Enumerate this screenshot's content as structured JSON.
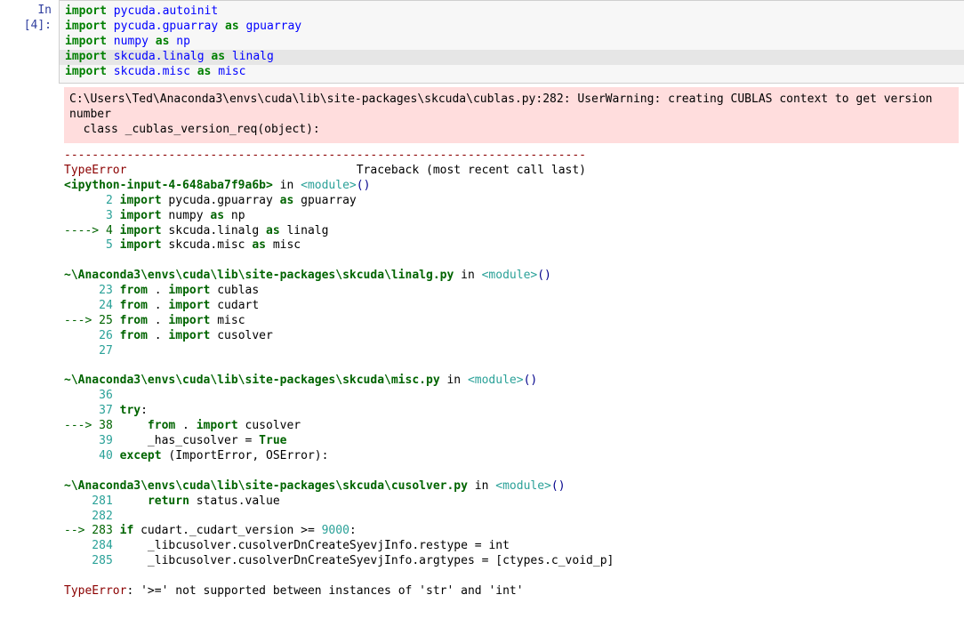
{
  "cell": {
    "prompt": "In [4]:",
    "input": {
      "l1": {
        "kw": "import",
        "mod": "pycuda.autoinit"
      },
      "l2": {
        "kw": "import",
        "mod": "pycuda.gpuarray",
        "as": "as",
        "alias": "gpuarray"
      },
      "l3": {
        "kw": "import",
        "mod": "numpy",
        "as": "as",
        "alias": "np"
      },
      "l4": {
        "kw": "import",
        "mod": "skcuda.linalg",
        "as": "as",
        "alias": "linalg"
      },
      "l5": {
        "kw": "import",
        "mod": "skcuda.misc",
        "as": "as",
        "alias": "misc"
      }
    }
  },
  "output": {
    "warning": {
      "line1": "C:\\Users\\Ted\\Anaconda3\\envs\\cuda\\lib\\site-packages\\skcuda\\cublas.py:282: UserWarning: creating CUBLAS context to get version number",
      "line2": "  class _cublas_version_req(object):"
    },
    "sep": "---------------------------------------------------------------------------",
    "errname": "TypeError",
    "tb_label": "                                 Traceback (most recent call last)",
    "f1": {
      "file": "<ipython-input-4-648aba7f9a6b>",
      "in": " in ",
      "mod": "<module>",
      "paren": "()",
      "l2": {
        "num": "      2 ",
        "kw": "import",
        "txt": " pycuda.gpuarray ",
        "as": "as",
        "txt2": " gpuarray"
      },
      "l3": {
        "num": "      3 ",
        "kw": "import",
        "txt": " numpy ",
        "as": "as",
        "txt2": " np"
      },
      "l4": {
        "arr": "----> 4 ",
        "kw": "import",
        "txt": " skcuda.linalg ",
        "as": "as",
        "txt2": " linalg"
      },
      "l5": {
        "num": "      5 ",
        "kw": "import",
        "txt": " skcuda.misc ",
        "as": "as",
        "txt2": " misc"
      }
    },
    "f2": {
      "file": "~\\Anaconda3\\envs\\cuda\\lib\\site-packages\\skcuda\\linalg.py",
      "in": " in ",
      "mod": "<module>",
      "paren": "()",
      "l23": {
        "num": "     23 ",
        "kw": "from",
        "d": " . ",
        "kw2": "import",
        "txt": " cublas"
      },
      "l24": {
        "num": "     24 ",
        "kw": "from",
        "d": " . ",
        "kw2": "import",
        "txt": " cudart"
      },
      "l25": {
        "arr": "---> 25 ",
        "kw": "from",
        "d": " . ",
        "kw2": "import",
        "txt": " misc"
      },
      "l26": {
        "num": "     26 ",
        "kw": "from",
        "d": " . ",
        "kw2": "import",
        "txt": " cusolver"
      },
      "l27": {
        "num": "     27 "
      }
    },
    "f3": {
      "file": "~\\Anaconda3\\envs\\cuda\\lib\\site-packages\\skcuda\\misc.py",
      "in": " in ",
      "mod": "<module>",
      "paren": "()",
      "l36": {
        "num": "     36 "
      },
      "l37": {
        "num": "     37 ",
        "kw": "try",
        "c": ":"
      },
      "l38": {
        "arr": "---> 38     ",
        "kw": "from",
        "d": " . ",
        "kw2": "import",
        "txt": " cusolver"
      },
      "l39": {
        "num": "     39 ",
        "txt": "    _has_cusolver ",
        "eq": "=",
        "sp": " ",
        "val": "True"
      },
      "l40": {
        "num": "     40 ",
        "kw": "except",
        "sp": " ",
        "p1": "(",
        "n1": "ImportError",
        "c": ",",
        "sp2": " ",
        "n2": "OSError",
        "p2": "):"
      }
    },
    "f4": {
      "file": "~\\Anaconda3\\envs\\cuda\\lib\\site-packages\\skcuda\\cusolver.py",
      "in": " in ",
      "mod": "<module>",
      "paren": "()",
      "l281": {
        "num": "    281 ",
        "sp": "    ",
        "kw": "return",
        "txt": " status.value"
      },
      "l282": {
        "num": "    282 "
      },
      "l283": {
        "arr": "--> 283 ",
        "kw": "if",
        "txt": " cudart._cudart_version ",
        "op": ">=",
        "sp": " ",
        "num2": "9000",
        "c": ":"
      },
      "l284": {
        "num": "    284 ",
        "txt": "    _libcusolver.cusolverDnCreateSyevjInfo.restype ",
        "eq": "=",
        "txt2": " int"
      },
      "l285": {
        "num": "    285 ",
        "txt": "    _libcusolver.cusolverDnCreateSyevjInfo.argtypes ",
        "eq": "=",
        "sp": " ",
        "b1": "[",
        "n1": "ctypes",
        "d": ".",
        "n2": "c_void_p",
        "b2": "]"
      }
    },
    "final": {
      "name": "TypeError",
      "msg": ": '>=' not supported between instances of 'str' and 'int'"
    }
  }
}
